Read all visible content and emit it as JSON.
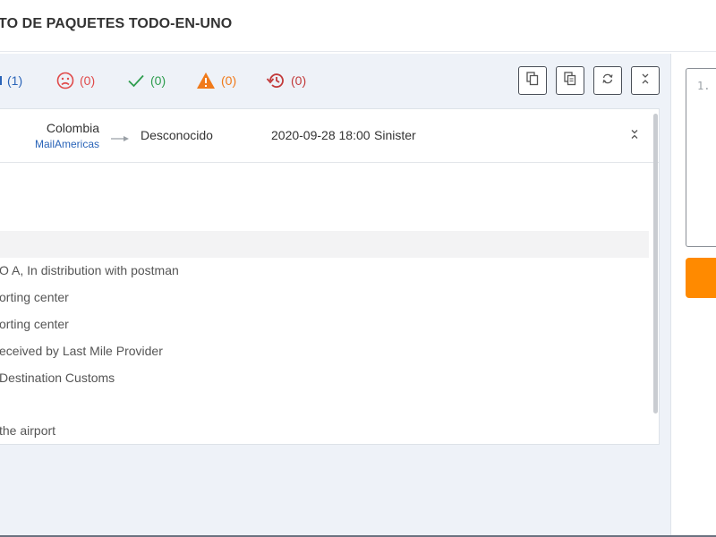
{
  "header": {
    "title": "TO DE PAQUETES TODO-EN-UNO"
  },
  "status_summary": [
    {
      "name": "in-transit",
      "count": "(1)",
      "color": "#2a64b8"
    },
    {
      "name": "not-found",
      "count": "(0)",
      "color": "#e04a4a"
    },
    {
      "name": "delivered",
      "count": "(0)",
      "color": "#2e9d4e"
    },
    {
      "name": "alert",
      "count": "(0)",
      "color": "#f07a1a"
    },
    {
      "name": "expired",
      "count": "(0)",
      "color": "#c23a3a"
    }
  ],
  "toolbar": {
    "buttons": [
      "copy-icon",
      "copy-all-icon",
      "refresh-icon",
      "collapse-all-icon"
    ]
  },
  "package": {
    "origin_country": "Colombia",
    "carrier": "MailAmericas",
    "destination_country": "Desconocido",
    "last_update": "2020-09-28 18:00",
    "last_status": "Sinister"
  },
  "events": [
    "O A, In distribution with postman",
    "orting center",
    "orting center",
    "eceived by Last Mile Provider",
    " Destination Customs",
    "the airport"
  ],
  "editor": {
    "line_number": "1."
  },
  "colors": {
    "accent": "#ff8a00",
    "link": "#2a64b8",
    "panel_bg": "#eef2f8"
  }
}
